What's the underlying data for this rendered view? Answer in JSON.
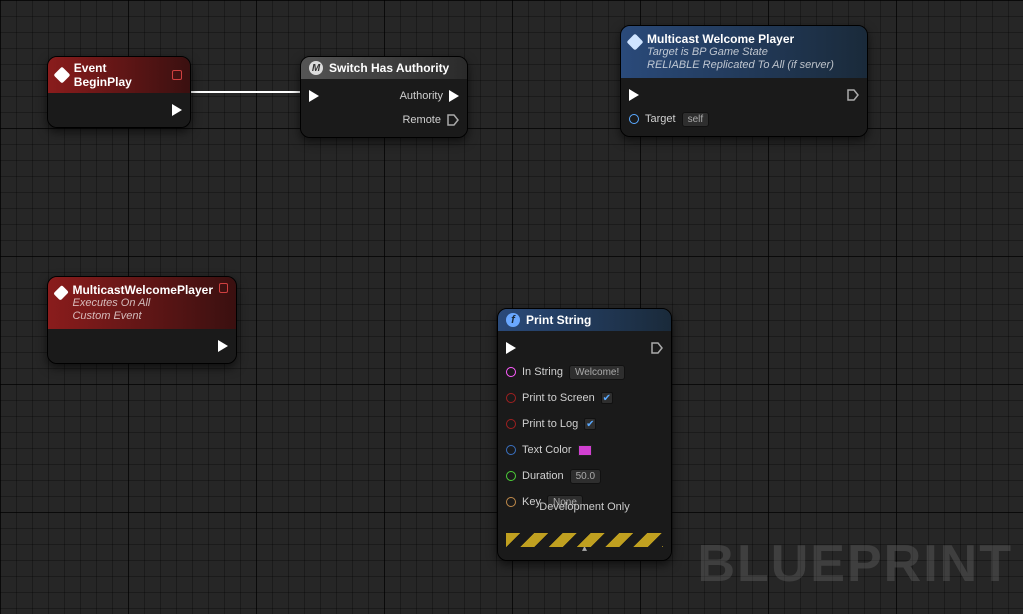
{
  "watermark": "BLUEPRINT",
  "nodes": {
    "beginPlay": {
      "title": "Event BeginPlay"
    },
    "switchAuth": {
      "title": "Switch Has Authority",
      "pins": {
        "authority": "Authority",
        "remote": "Remote"
      }
    },
    "multicastCall": {
      "title": "Multicast Welcome Player",
      "sub1": "Target is BP Game State",
      "sub2": "RELIABLE Replicated To All (if server)",
      "pins": {
        "target": "Target",
        "self": "self"
      }
    },
    "multicastEvent": {
      "title": "MulticastWelcomePlayer",
      "sub1": "Executes On All",
      "sub2": "Custom Event"
    },
    "printString": {
      "title": "Print String",
      "pins": {
        "inString": "In String",
        "inStringVal": "Welcome!",
        "printScreen": "Print to Screen",
        "printLog": "Print to Log",
        "textColor": "Text Color",
        "textColorVal": "#d040d0",
        "duration": "Duration",
        "durationVal": "50.0",
        "key": "Key",
        "keyVal": "None"
      },
      "devLabel": "Development Only"
    }
  }
}
